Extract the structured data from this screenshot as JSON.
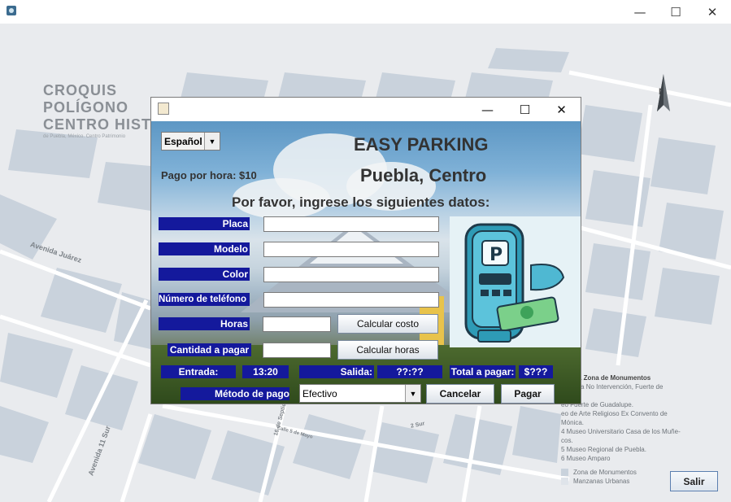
{
  "window": {
    "icon": "app-icon",
    "minimize": "—",
    "maximize": "☐",
    "close": "✕"
  },
  "map": {
    "title_lines": [
      "CROQUIS",
      "POLÍGONO",
      "CENTRO HIST"
    ],
    "subtitle": "de Puebla, México. Centro Patrimonio",
    "north": "N",
    "streets": [
      "Avenida Juárez",
      "Avenida 11 Sur",
      "16 de Septiembre",
      "Calle 5 de Mayo",
      "2 Sur"
    ],
    "legend": {
      "items": [
        "o de la Zona de Monumentos",
        "eo de la No Intervención, Fuerte    de",
        "",
        "eo Fuerte de Guadalupe.",
        "eo de Arte Religioso Ex Convento de",
        "Mónica.",
        "4  Museo Universitario Casa de los Muñe-",
        "cos.",
        "5  Museo Regional de Puebla.",
        "6  Museo Amparo",
        "",
        "Zona de Monumentos",
        "Manzanas Urbanas"
      ]
    },
    "exit_label": "Salir"
  },
  "dialog": {
    "language": {
      "value": "Español",
      "arrow": "▼"
    },
    "title": "EASY PARKING",
    "subtitle": "Puebla, Centro",
    "rate": "Pago por hora: $10",
    "instructions": "Por favor, ingrese los siguientes datos:",
    "fields": {
      "placa": {
        "label": "Placa",
        "value": ""
      },
      "modelo": {
        "label": "Modelo",
        "value": ""
      },
      "color": {
        "label": "Color",
        "value": ""
      },
      "telefono": {
        "label": "Número de teléfono",
        "value": ""
      },
      "horas": {
        "label": "Horas",
        "value": ""
      },
      "cantidad": {
        "label": "Cantidad a pagar",
        "value": ""
      }
    },
    "buttons": {
      "calcular_costo": "Calcular costo",
      "calcular_horas": "Calcular horas",
      "cancelar": "Cancelar",
      "pagar": "Pagar"
    },
    "entrada": {
      "label": "Entrada:",
      "value": "13:20"
    },
    "salida": {
      "label": "Salida:",
      "value": "??:??"
    },
    "total": {
      "label": "Total a pagar:",
      "value": "$???"
    },
    "metodo": {
      "label": "Método de pago",
      "value": "Efectivo",
      "arrow": "▼"
    },
    "image": "parking-meter-illustration"
  }
}
